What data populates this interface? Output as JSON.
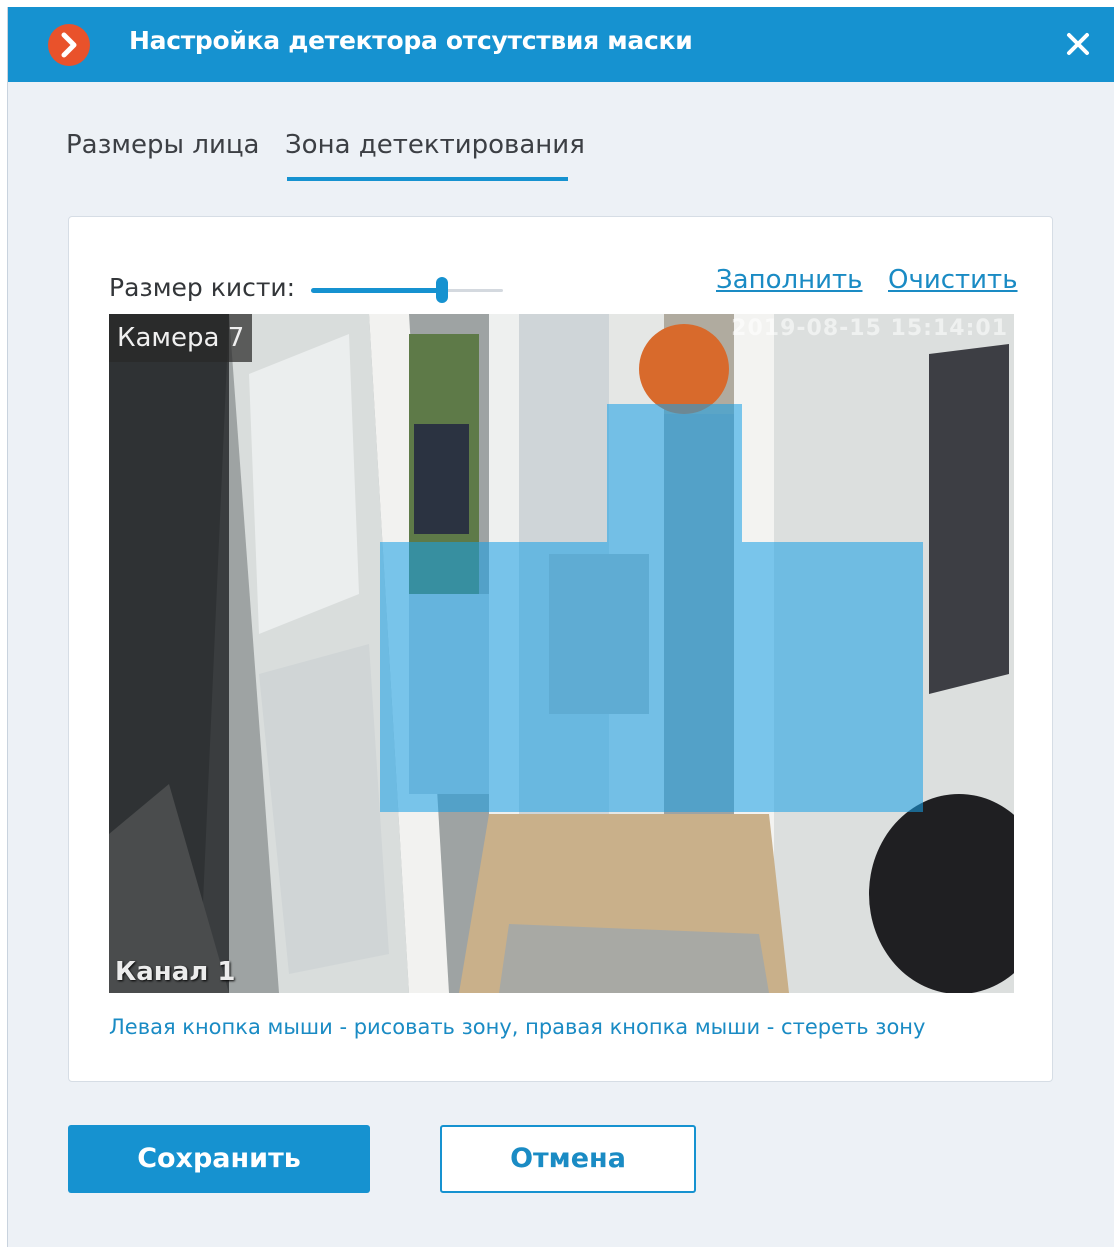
{
  "window": {
    "title": "Настройка детектора отсутствия маски",
    "logo_icon": "app-logo-chevron",
    "close_icon": "close-icon"
  },
  "tabs": [
    {
      "label": "Размеры лица",
      "active": false
    },
    {
      "label": "Зона детектирования",
      "active": true
    }
  ],
  "zone_editor": {
    "brush_label": "Размер кисти:",
    "brush_size_fraction": 0.68,
    "fill_link": "Заполнить",
    "clear_link": "Очистить",
    "hint": "Левая кнопка мыши - рисовать зону, правая кнопка мыши - стереть зону"
  },
  "video": {
    "camera_label": "Камера 7",
    "timestamp": "2019-08-15 15:14:01",
    "channel_label": "Канал 1"
  },
  "buttons": {
    "save": "Сохранить",
    "cancel": "Отмена"
  },
  "colors": {
    "accent": "#1692d0",
    "logo": "#e9522b",
    "zone_overlay": "rgba(25,160,230,0.56)"
  }
}
